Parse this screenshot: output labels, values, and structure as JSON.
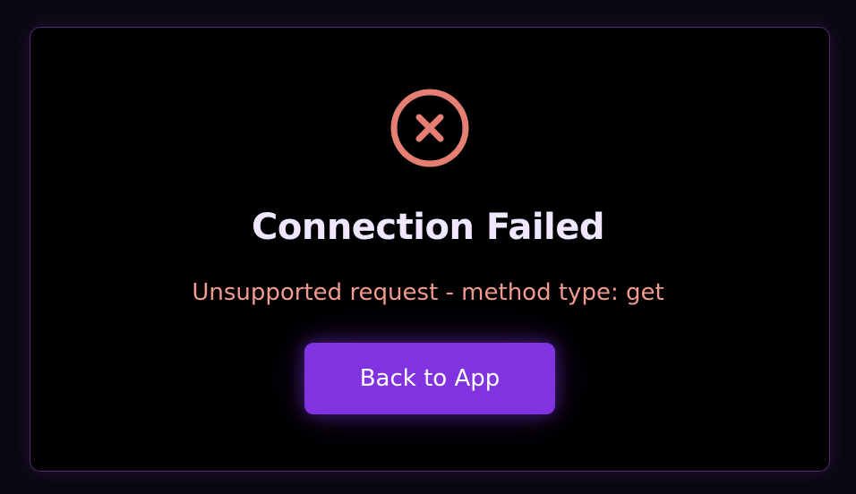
{
  "dialog": {
    "icon": "error-circle-x-icon",
    "title": "Connection Failed",
    "message": "Unsupported request - method type: get",
    "back_button_label": "Back to App"
  },
  "colors": {
    "background": "#0a0810",
    "card_background": "#000000",
    "card_border": "#4b2a78",
    "icon": "#e57f74",
    "title": "#efe6ff",
    "message": "#f09a90",
    "button": "#8133e0",
    "button_text": "#ffffff"
  }
}
